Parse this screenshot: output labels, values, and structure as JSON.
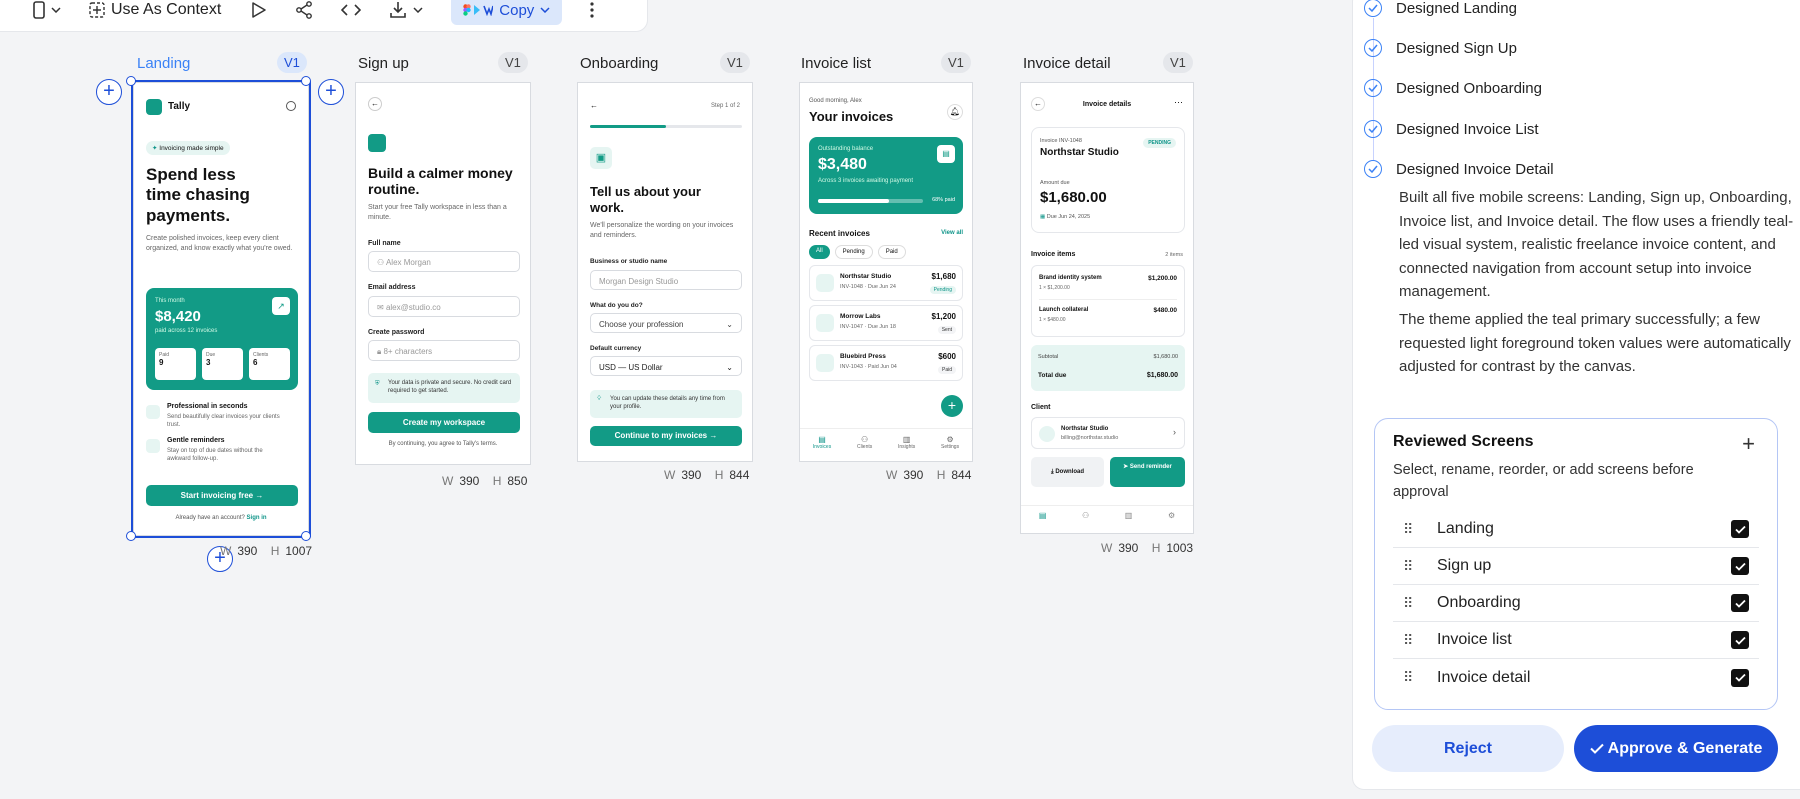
{
  "toolbar": {
    "use_as_context": "Use As Context",
    "copy": "Copy"
  },
  "artboards": [
    {
      "label": "Landing",
      "version": "V1",
      "w": "390",
      "h": "1007"
    },
    {
      "label": "Sign up",
      "version": "V1",
      "w": "390",
      "h": "850"
    },
    {
      "label": "Onboarding",
      "version": "V1",
      "w": "390",
      "h": "844"
    },
    {
      "label": "Invoice list",
      "version": "V1",
      "w": "390",
      "h": "844"
    },
    {
      "label": "Invoice detail",
      "version": "V1",
      "w": "390",
      "h": "1003"
    }
  ],
  "dim_labels": {
    "w": "W",
    "h": "H"
  },
  "landing": {
    "brand": "Tally",
    "pill": "Invoicing made simple",
    "headline": "Spend less time chasing payments.",
    "body": "Create polished invoices, keep every client organized, and know exactly what you're owed.",
    "card_label": "This month",
    "card_amount": "$8,420",
    "card_sub": "paid across 12 invoices",
    "stats": [
      {
        "label": "Paid",
        "value": "9"
      },
      {
        "label": "Due",
        "value": "3"
      },
      {
        "label": "Clients",
        "value": "6"
      }
    ],
    "features": [
      {
        "title": "Professional in seconds",
        "body": "Send beautifully clear invoices your clients trust."
      },
      {
        "title": "Gentle reminders",
        "body": "Stay on top of due dates without the awkward follow-up."
      }
    ],
    "cta": "Start invoicing free →",
    "footer": "Already have an account?",
    "footer_link": "Sign in"
  },
  "signup": {
    "title": "Build a calmer money routine.",
    "subtitle": "Start your free Tally workspace in less than a minute.",
    "full_name_label": "Full name",
    "full_name_ph": "Alex Morgan",
    "email_label": "Email address",
    "email_ph": "alex@studio.co",
    "password_label": "Create password",
    "password_ph": "8+ characters",
    "notice": "Your data is private and secure. No credit card required to get started.",
    "cta": "Create my workspace",
    "terms": "By continuing, you agree to Tally's terms."
  },
  "onboarding": {
    "step": "Step 1 of 2",
    "progress": 0.5,
    "title": "Tell us about your work.",
    "subtitle": "We'll personalize the wording on your invoices and reminders.",
    "business_label": "Business or studio name",
    "business_ph": "Morgan Design Studio",
    "profession_label": "What do you do?",
    "profession_ph": "Choose your profession",
    "currency_label": "Default currency",
    "currency_value": "USD — US Dollar",
    "hint": "You can update these details any time from your profile.",
    "cta": "Continue to my invoices →"
  },
  "invoice_list": {
    "greeting": "Good morning, Alex",
    "title": "Your invoices",
    "balance_label": "Outstanding balance",
    "balance": "$3,480",
    "balance_sub": "Across 3 invoices awaiting payment",
    "paid_pct": "68% paid",
    "paid_fraction": 0.68,
    "recent": "Recent invoices",
    "view_all": "View all",
    "filters": [
      "All",
      "Pending",
      "Paid"
    ],
    "rows": [
      {
        "name": "Northstar Studio",
        "meta": "INV-1048 · Due Jun 24",
        "amount": "$1,680",
        "status": "Pending"
      },
      {
        "name": "Morrow Labs",
        "meta": "INV-1047 · Due Jun 18",
        "amount": "$1,200",
        "status": "Sent"
      },
      {
        "name": "Bluebird Press",
        "meta": "INV-1043 · Paid Jun 04",
        "amount": "$600",
        "status": "Paid"
      }
    ],
    "fab": "+",
    "nav": [
      "Invoices",
      "Clients",
      "Insights",
      "Settings"
    ]
  },
  "invoice_detail": {
    "header": "Invoice details",
    "inv_no": "Invoice INV-1048",
    "client": "Northstar Studio",
    "status": "PENDING",
    "amount_label": "Amount due",
    "amount": "$1,680.00",
    "due": "Due Jun 24, 2025",
    "items_label": "Invoice items",
    "items_count": "2 items",
    "items": [
      {
        "name": "Brand identity system",
        "qty": "1 × $1,200.00",
        "total": "$1,200.00"
      },
      {
        "name": "Launch collateral",
        "qty": "1 × $480.00",
        "total": "$480.00"
      }
    ],
    "subtotal_label": "Subtotal",
    "subtotal": "$1,680.00",
    "total_label": "Total due",
    "total": "$1,680.00",
    "client_label": "Client",
    "client_email": "billing@northstar.studio",
    "download": "Download",
    "reminder": "Send reminder"
  },
  "panel": {
    "steps": [
      "Designed Landing",
      "Designed Sign Up",
      "Designed Onboarding",
      "Designed Invoice List",
      "Designed Invoice Detail"
    ],
    "summary_1": "Built all five mobile screens: Landing, Sign up, Onboarding, Invoice list, and Invoice detail. The flow uses a friendly teal-led visual system, realistic freelance invoice content, and connected navigation from account setup into invoice management.",
    "summary_2": "The theme applied the teal primary successfully; a few requested light foreground token values were automatically adjusted for contrast by the canvas.",
    "reviewed_title": "Reviewed Screens",
    "reviewed_sub": "Select, rename, reorder, or add screens before approval",
    "screens": [
      "Landing",
      "Sign up",
      "Onboarding",
      "Invoice list",
      "Invoice detail"
    ],
    "reject": "Reject",
    "approve": "Approve & Generate"
  }
}
